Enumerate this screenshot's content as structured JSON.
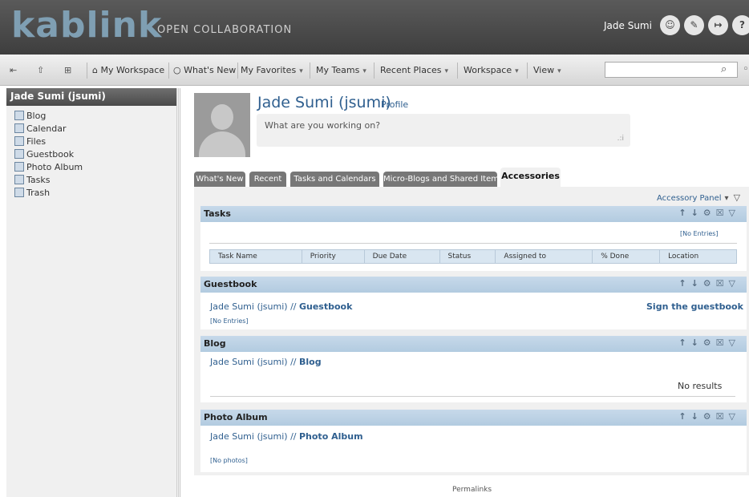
{
  "header": {
    "logo_text": "kablink",
    "tagline": "OPEN COLLABORATION",
    "user_name": "Jade Sumi",
    "icons": [
      "user-menu-icon",
      "notes-icon",
      "logout-icon",
      "help-icon"
    ]
  },
  "toolbar": {
    "items": [
      "My Workspace",
      "What's New",
      "My Favorites",
      "My Teams",
      "Recent Places",
      "Workspace",
      "View"
    ],
    "search": {
      "placeholder": ""
    }
  },
  "sidebar": {
    "title": "Jade Sumi (jsumi)",
    "items": [
      {
        "label": "Blog",
        "icon": "blog-icon"
      },
      {
        "label": "Calendar",
        "icon": "calendar-icon"
      },
      {
        "label": "Files",
        "icon": "files-icon"
      },
      {
        "label": "Guestbook",
        "icon": "guestbook-icon"
      },
      {
        "label": "Photo Album",
        "icon": "photo-album-icon"
      },
      {
        "label": "Tasks",
        "icon": "tasks-icon"
      },
      {
        "label": "Trash",
        "icon": "trash-icon"
      }
    ]
  },
  "profile": {
    "name": "Jade Sumi (jsumi)",
    "profile_link": "Profile",
    "status_placeholder": "What are you working on?"
  },
  "tabs": [
    {
      "label": "What's New"
    },
    {
      "label": "Recent"
    },
    {
      "label": "Tasks and Calendars"
    },
    {
      "label": "Micro-Blogs and Shared Items"
    },
    {
      "label": "Accessories",
      "active": true
    }
  ],
  "accessory_panel": "Accessory Panel",
  "sections": {
    "tasks": {
      "title": "Tasks",
      "no_entries": "[No Entries]",
      "columns": [
        "Task Name",
        "Priority",
        "Due Date",
        "Status",
        "Assigned to",
        "% Done",
        "Location"
      ]
    },
    "guestbook": {
      "title": "Guestbook",
      "owner": "Jade Sumi (jsumi) // ",
      "link": "Guestbook",
      "sign": "Sign the guestbook",
      "no_entries": "[No Entries]"
    },
    "blog": {
      "title": "Blog",
      "owner": "Jade Sumi (jsumi) // ",
      "link": "Blog",
      "no_results": "No results"
    },
    "photo_album": {
      "title": "Photo Album",
      "owner": "Jade Sumi (jsumi) // ",
      "link": "Photo Album",
      "no_photos": "[No photos]"
    }
  },
  "footer": {
    "permalinks": "Permalinks"
  },
  "colors": {
    "accent": "#2f5f8f",
    "header_bg": "#4a4a4a",
    "section_header": "#bcd2e5"
  }
}
